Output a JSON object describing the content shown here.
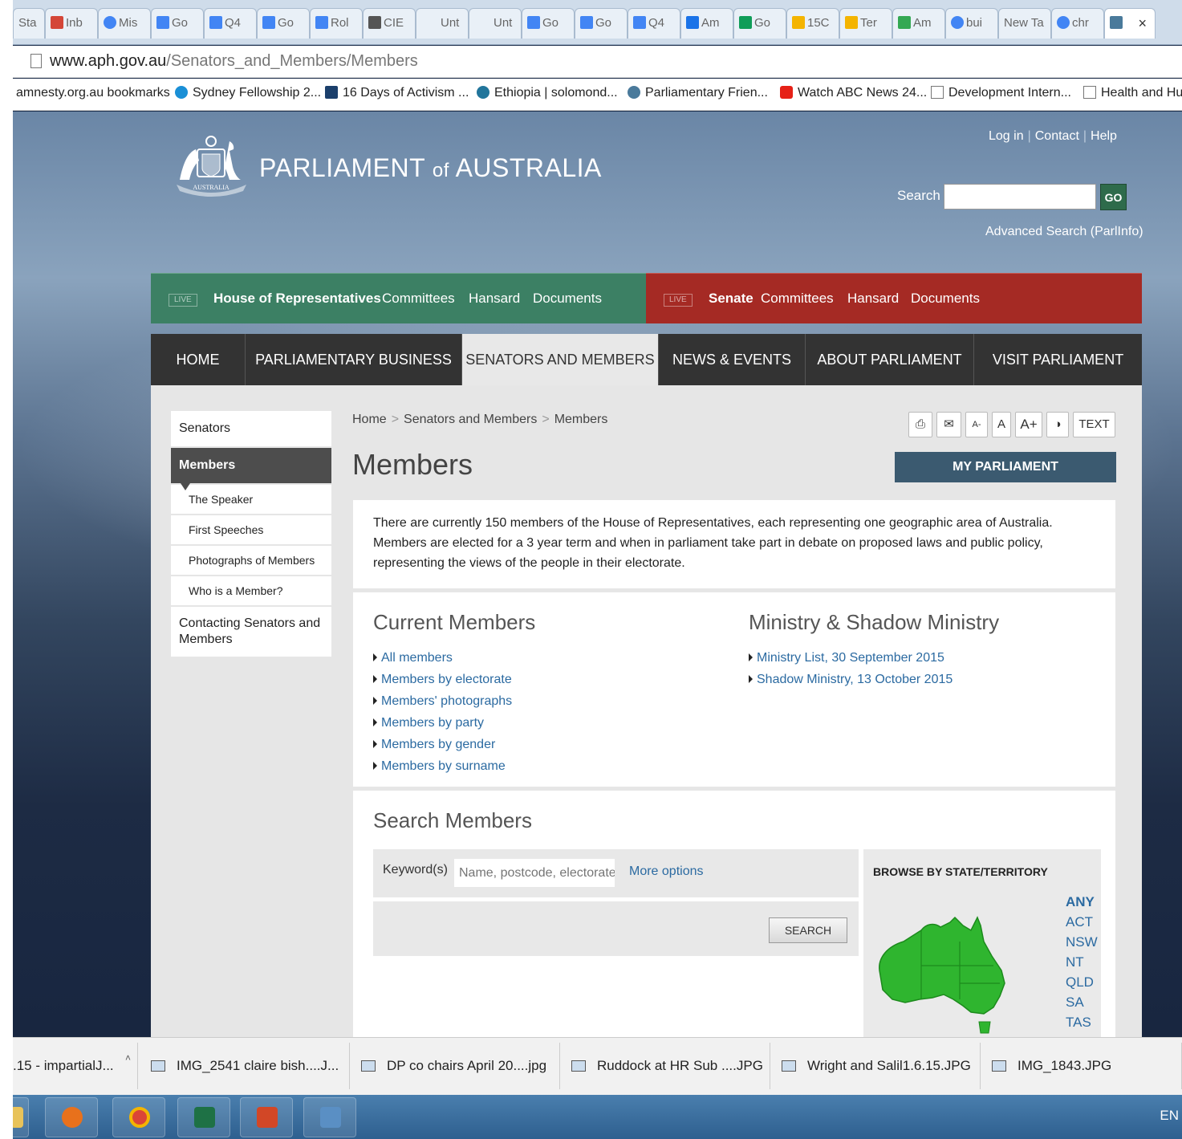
{
  "browser": {
    "tabs": [
      {
        "label": "Sta",
        "color": "#ffffff"
      },
      {
        "label": "Inb",
        "color": "#d44638"
      },
      {
        "label": "Mis",
        "color": "#4285f4"
      },
      {
        "label": "Go",
        "color": "#4285f4"
      },
      {
        "label": "Q4",
        "color": "#4285f4"
      },
      {
        "label": "Go",
        "color": "#4285f4"
      },
      {
        "label": "Rol",
        "color": "#4285f4"
      },
      {
        "label": "CIE",
        "color": "#555555"
      },
      {
        "label": "Unt",
        "color": "#ffffff"
      },
      {
        "label": "Unt",
        "color": "#ffffff"
      },
      {
        "label": "Go",
        "color": "#4285f4"
      },
      {
        "label": "Go",
        "color": "#4285f4"
      },
      {
        "label": "Q4",
        "color": "#4285f4"
      },
      {
        "label": "Am",
        "color": "#1a73e8"
      },
      {
        "label": "Go",
        "color": "#0f9d58"
      },
      {
        "label": "15C",
        "color": "#f4b400"
      },
      {
        "label": "Ter",
        "color": "#f4b400"
      },
      {
        "label": "Am",
        "color": "#34a853"
      },
      {
        "label": "bui",
        "color": "#4285f4"
      },
      {
        "label": "New Ta",
        "color": "#ffffff"
      },
      {
        "label": "chr",
        "color": "#4285f4"
      }
    ],
    "active_tab_close": "×",
    "url_host": "www.aph.gov.au",
    "url_path": "/Senators_and_Members/Members",
    "bookmarks": [
      {
        "label": "amnesty.org.au bookmarks",
        "color": "#ffffff"
      },
      {
        "label": "Sydney Fellowship 2...",
        "color": "#1a8fd6"
      },
      {
        "label": "16 Days of Activism ...",
        "color": "#1b3f6b"
      },
      {
        "label": "Ethiopia | solomond...",
        "color": "#21759b"
      },
      {
        "label": "Parliamentary Frien...",
        "color": "#4a7a9b"
      },
      {
        "label": "Watch ABC News 24...",
        "color": "#e62117"
      },
      {
        "label": "Development Intern...",
        "color": "#ffffff"
      },
      {
        "label": "Health and Hu",
        "color": "#ffffff"
      }
    ]
  },
  "header": {
    "title_main": "PARLIAMENT",
    "title_of": "of",
    "title_country": "AUSTRALIA",
    "logo_text": "AUSTRALIA",
    "util_login": "Log in",
    "util_contact": "Contact",
    "util_help": "Help",
    "search_label": "Search",
    "search_value": "",
    "go_label": "GO",
    "advanced_search": "Advanced Search (ParlInfo)"
  },
  "chambers": {
    "live": "LIVE",
    "house": {
      "name": "House of Representatives",
      "committees": "Committees",
      "hansard": "Hansard",
      "documents": "Documents"
    },
    "senate": {
      "name": "Senate",
      "committees": "Committees",
      "hansard": "Hansard",
      "documents": "Documents"
    }
  },
  "mainnav": {
    "home": "HOME",
    "business": "PARLIAMENTARY BUSINESS",
    "senators_members": "SENATORS AND MEMBERS",
    "news": "NEWS & EVENTS",
    "about": "ABOUT PARLIAMENT",
    "visit": "VISIT PARLIAMENT"
  },
  "sidenav": {
    "senators": "Senators",
    "members": "Members",
    "speaker": "The Speaker",
    "first_speeches": "First Speeches",
    "photographs": "Photographs of Members",
    "who": "Who is a Member?",
    "contacting": "Contacting Senators and Members"
  },
  "breadcrumb": {
    "home": "Home",
    "sep": ">",
    "senators_members": "Senators and Members",
    "members": "Members"
  },
  "page_title": "Members",
  "tools": {
    "print": "⎙",
    "email": "✉",
    "smaller": "A-",
    "normal": "A",
    "larger": "A+",
    "contrast": "◑",
    "text": "TEXT"
  },
  "my_parliament": "MY PARLIAMENT",
  "intro_text": "There are currently 150 members of the House of Representatives, each representing one geographic area of Australia. Members are elected for a 3 year term and when in parliament take part in debate on proposed laws and public policy, representing the views of the people in their electorate.",
  "current_members": {
    "title": "Current Members",
    "links": [
      "All members",
      "Members by electorate",
      "Members' photographs",
      "Members by party",
      "Members by gender",
      "Members by surname"
    ]
  },
  "ministry": {
    "title": "Ministry & Shadow Ministry",
    "links": [
      "Ministry List, 30 September 2015",
      "Shadow Ministry, 13 October 2015"
    ]
  },
  "search_members": {
    "title": "Search Members",
    "keyword_label": "Keyword(s)",
    "keyword_placeholder": "Name, postcode, electorate",
    "more_options": "More options",
    "search_button": "SEARCH",
    "browse_title": "BROWSE BY STATE/TERRITORY",
    "states": [
      "ANY",
      "ACT",
      "NSW",
      "NT",
      "QLD",
      "SA",
      "TAS"
    ],
    "selected_state": "ANY"
  },
  "downloads": [
    {
      "label": ".15 - impartialJ..."
    },
    {
      "label": "IMG_2541 claire bish....J..."
    },
    {
      "label": "DP co chairs April 20....jpg"
    },
    {
      "label": "Ruddock at HR Sub ....JPG"
    },
    {
      "label": "Wright and Salil1.6.15.JPG"
    },
    {
      "label": "IMG_1843.JPG"
    }
  ],
  "taskbar": {
    "apps": [
      {
        "name": "media-player",
        "color": "#e8711c"
      },
      {
        "name": "chrome",
        "color": "#db4437"
      },
      {
        "name": "excel",
        "color": "#1e7145"
      },
      {
        "name": "powerpoint",
        "color": "#d24726"
      },
      {
        "name": "photo-viewer",
        "color": "#5a8fc4"
      }
    ],
    "lang": "EN"
  },
  "colors": {
    "house": "#3c8064",
    "senate": "#a52a24",
    "link": "#2b6aa1",
    "map_green": "#2fb52f"
  }
}
